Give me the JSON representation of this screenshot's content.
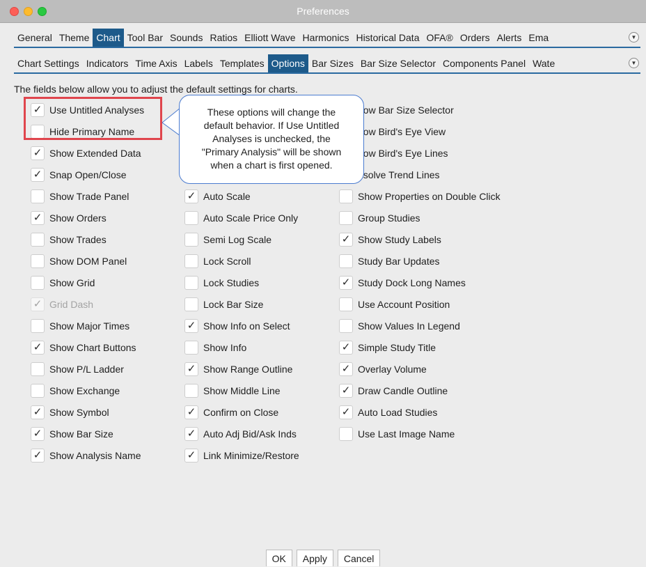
{
  "window": {
    "title": "Preferences"
  },
  "tabs_primary": [
    "General",
    "Theme",
    "Chart",
    "Tool Bar",
    "Sounds",
    "Ratios",
    "Elliott Wave",
    "Harmonics",
    "Historical Data",
    "OFA®",
    "Orders",
    "Alerts",
    "Ema"
  ],
  "tabs_primary_active": "Chart",
  "tabs_secondary": [
    "Chart Settings",
    "Indicators",
    "Time Axis",
    "Labels",
    "Templates",
    "Options",
    "Bar Sizes",
    "Bar Size Selector",
    "Components Panel",
    "Wate"
  ],
  "tabs_secondary_active": "Options",
  "more_tabs_icon": "chevron-down-circle-icon",
  "intro_text": "The fields below allow you to adjust the default settings for charts.",
  "options": {
    "col1": [
      {
        "label": "Use Untitled Analyses",
        "checked": true
      },
      {
        "label": "Hide Primary Name",
        "checked": false
      },
      {
        "label": "Show Extended Data",
        "checked": true
      },
      {
        "label": "Snap Open/Close",
        "checked": true
      },
      {
        "label": "Show Trade Panel",
        "checked": false
      },
      {
        "label": "Show Orders",
        "checked": true
      },
      {
        "label": "Show Trades",
        "checked": false
      },
      {
        "label": "Show DOM Panel",
        "checked": false
      },
      {
        "label": "Show Grid",
        "checked": false
      },
      {
        "label": "Grid Dash",
        "checked": true,
        "disabled": true
      },
      {
        "label": "Show Major Times",
        "checked": false
      },
      {
        "label": "Show Chart Buttons",
        "checked": true
      },
      {
        "label": "Show P/L Ladder",
        "checked": false
      },
      {
        "label": "Show Exchange",
        "checked": false
      },
      {
        "label": "Show Symbol",
        "checked": true
      },
      {
        "label": "Show Bar Size",
        "checked": true
      },
      {
        "label": "Show Analysis Name",
        "checked": true
      }
    ],
    "col2": [
      {
        "label": "",
        "hidden": true
      },
      {
        "label": "",
        "hidden": true
      },
      {
        "label": "",
        "hidden": true
      },
      {
        "label": "",
        "hidden": true
      },
      {
        "label": "Auto Scale",
        "checked": true
      },
      {
        "label": "Auto Scale Price Only",
        "checked": false
      },
      {
        "label": "Semi Log Scale",
        "checked": false
      },
      {
        "label": "Lock Scroll",
        "checked": false
      },
      {
        "label": "Lock Studies",
        "checked": false
      },
      {
        "label": "Lock Bar Size",
        "checked": false
      },
      {
        "label": "Show Info on Select",
        "checked": true
      },
      {
        "label": "Show Info",
        "checked": false
      },
      {
        "label": "Show Range Outline",
        "checked": true
      },
      {
        "label": "Show Middle Line",
        "checked": false
      },
      {
        "label": "Confirm on Close",
        "checked": true
      },
      {
        "label": "Auto Adj Bid/Ask Inds",
        "checked": true
      },
      {
        "label": "Link Minimize/Restore",
        "checked": true
      }
    ],
    "col3": [
      {
        "label": "how Bar Size Selector",
        "partial": true
      },
      {
        "label": "how Bird's Eye View",
        "partial": true
      },
      {
        "label": "how Bird's Eye Lines",
        "partial": true
      },
      {
        "label": "esolve Trend Lines",
        "partial": true
      },
      {
        "label": "Show Properties on Double Click",
        "checked": false
      },
      {
        "label": "Group Studies",
        "checked": false
      },
      {
        "label": "Show Study Labels",
        "checked": true
      },
      {
        "label": "Study Bar Updates",
        "checked": false
      },
      {
        "label": "Study Dock Long Names",
        "checked": true
      },
      {
        "label": "Use Account Position",
        "checked": false
      },
      {
        "label": "Show Values In Legend",
        "checked": false
      },
      {
        "label": "Simple Study Title",
        "checked": true
      },
      {
        "label": "Overlay Volume",
        "checked": true
      },
      {
        "label": "Draw Candle Outline",
        "checked": true
      },
      {
        "label": "Auto Load Studies",
        "checked": true
      },
      {
        "label": "Use Last Image Name",
        "checked": false
      }
    ]
  },
  "callout": {
    "lines": [
      "These options will change the",
      "default behavior. If Use Untitled",
      "Analyses is unchecked, the",
      "\"Primary Analysis\" will be shown",
      "when a chart is first opened."
    ],
    "border_color": "#4a7bd0"
  },
  "highlight_color": "#e0454d",
  "accent_color": "#1d5a8a",
  "buttons": {
    "ok": "OK",
    "apply": "Apply",
    "cancel": "Cancel"
  }
}
